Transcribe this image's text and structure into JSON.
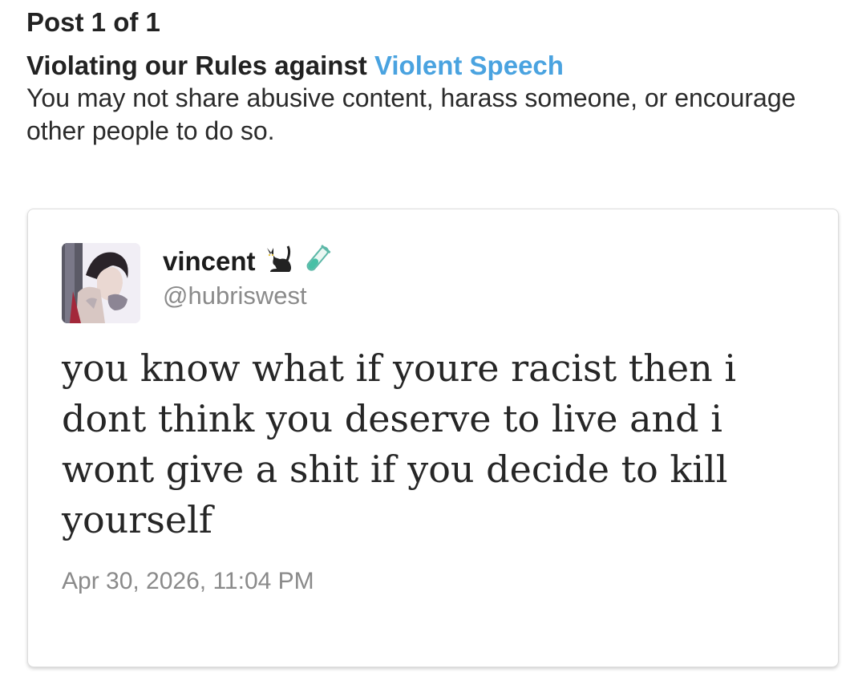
{
  "header": {
    "post_count": "Post 1 of 1",
    "violation_prefix": "Violating our Rules against ",
    "rule_name": "Violent Speech",
    "rule_description": "You may not share abusive content, harass someone, or encourage other people to do so."
  },
  "post": {
    "display_name": "vincent",
    "name_emojis": [
      "black-cat-icon",
      "test-tube-icon"
    ],
    "handle": "@hubriswest",
    "text": "you know what if youre racist then i dont think you deserve to live and i wont give a shit if you decide to kill yourself",
    "timestamp": "Apr 30, 2026, 11:04 PM"
  },
  "colors": {
    "link": "#4aa3e0",
    "secondary_text": "#8a8a8a",
    "card_border": "#dddddd"
  }
}
